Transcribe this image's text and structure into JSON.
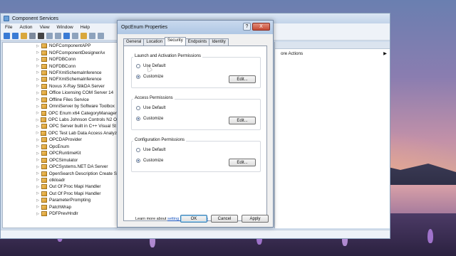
{
  "main_window": {
    "title": "Component Services",
    "menu": [
      "File",
      "Action",
      "View",
      "Window",
      "Help"
    ],
    "tree_items": [
      "NOFComponentAPP",
      "NOFComponentDesignerAx",
      "NOFDBConn",
      "NOFDBConn",
      "NOFXmlSchemaInference",
      "NOFXmlSchemaInference",
      "Novus X-Ray SlikDA Server",
      "Office Licensing COM Server 14",
      "Offline Files Service",
      "OmniServer by Software Toolbox",
      "OPC Enum x64 CategoryManager",
      "OPC Labs Johnson Controls N2 O",
      "OPC Server built in C++ Visual St",
      "OPC Test Lab Data Access Analyz",
      "OPCDAProvider",
      "OpcEnum",
      "OPCRuntimeKit",
      "OPCSimulator",
      "OPCSystems.NET DA Server",
      "OpenSearch Description Create S",
      "otkloadr",
      "Out Of Proc Mapi Handler",
      "Out Of Proc Mapi Handler",
      "ParameterPrompting",
      "PatchWrap",
      "PDFPrevHndlr"
    ],
    "actions_more": "ore Actions"
  },
  "dialog": {
    "title": "OpcEnum Properties",
    "help_glyph": "?",
    "close_glyph": "X",
    "tabs": [
      "General",
      "Location",
      "Security",
      "Endpoints",
      "Identity"
    ],
    "groups": [
      {
        "title": "Launch and Activation Permissions",
        "opt1": "Use Default",
        "opt2": "Customize",
        "edit": "Edit..."
      },
      {
        "title": "Access Permissions",
        "opt1": "Use Default",
        "opt2": "Customize",
        "edit": "Edit..."
      },
      {
        "title": "Configuration Permissions",
        "opt1": "Use Default",
        "opt2": "Customize",
        "edit": "Edit..."
      }
    ],
    "learn_prefix": "Learn more about ",
    "learn_link": "setting these properties",
    "ok": "OK",
    "cancel": "Cancel",
    "apply": "Apply"
  }
}
